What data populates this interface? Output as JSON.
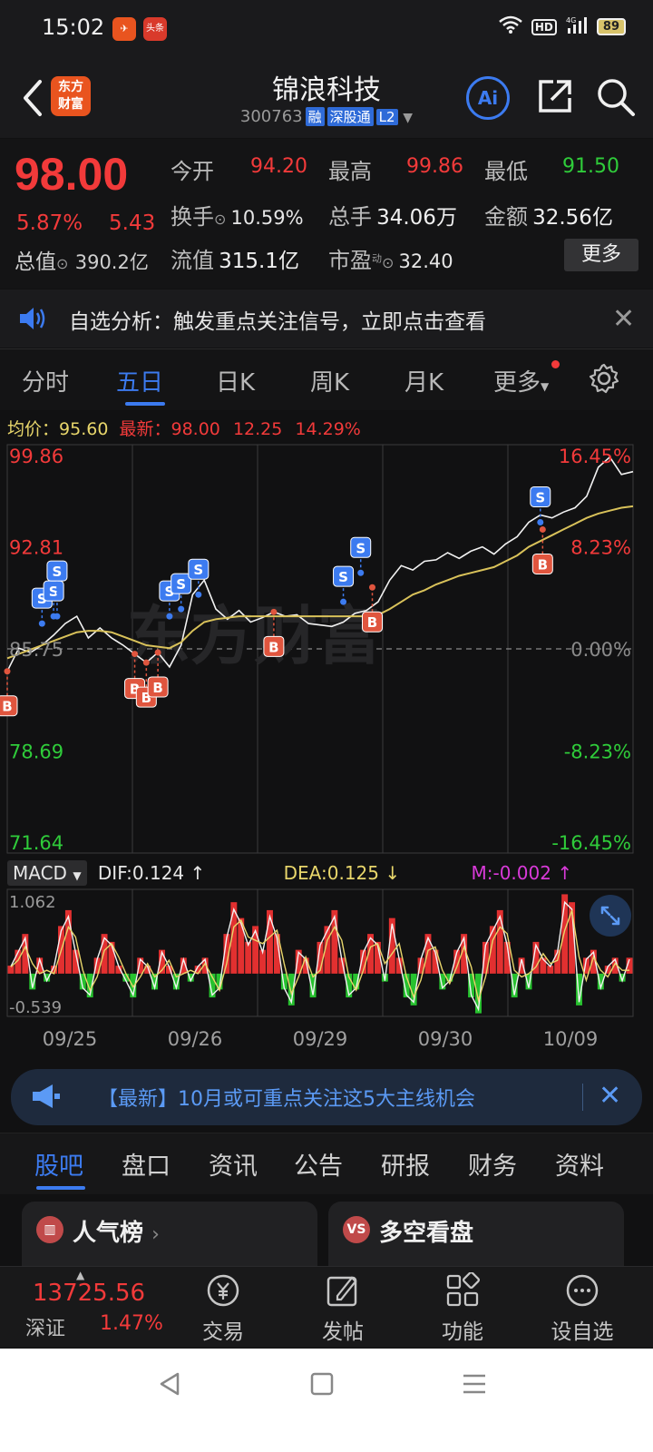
{
  "status": {
    "time": "15:02",
    "battery": "89",
    "badge2": "头条"
  },
  "header": {
    "logo_line1": "东方",
    "logo_line2": "财富",
    "stock_name": "锦浪科技",
    "stock_code": "300763",
    "tags": [
      "融",
      "深股通",
      "L2"
    ],
    "ai_label": "Ai"
  },
  "quote": {
    "price": "98.00",
    "change_pct": "5.87%",
    "change_abs": "5.43",
    "open_label": "今开",
    "open": "94.20",
    "high_label": "最高",
    "high": "99.86",
    "low_label": "最低",
    "low": "91.50",
    "turnover_label": "换手",
    "turnover": "10.59%",
    "volume_label": "总手",
    "volume": "34.06万",
    "amount_label": "金额",
    "amount": "32.56亿",
    "mcap_label": "总值",
    "mcap": "390.2亿",
    "float_label": "流值",
    "float": "315.1亿",
    "pe_label": "市盈",
    "pe_sup": "动",
    "pe": "32.40",
    "more": "更多"
  },
  "notice": {
    "text": "自选分析：触发重点关注信号，立即点击查看"
  },
  "chart_tabs": [
    "分时",
    "五日",
    "日K",
    "周K",
    "月K",
    "更多"
  ],
  "avg_row": {
    "avg_label": "均价：",
    "avg_value": "95.60",
    "latest_label": "最新：",
    "latest_value": "98.00",
    "latest_chg": "12.25",
    "latest_pct": "14.29%"
  },
  "chart_data": {
    "type": "line",
    "x_labels": [
      "09/25",
      "09/26",
      "09/29",
      "09/30",
      "10/09"
    ],
    "y_left_ticks": [
      "99.86",
      "92.81",
      "85.75",
      "78.69",
      "71.64"
    ],
    "y_right_ticks": [
      "16.45%",
      "8.23%",
      "0.00%",
      "-8.23%",
      "-16.45%"
    ],
    "ylim": [
      71.64,
      99.86
    ],
    "prev_close": 85.75,
    "series": [
      {
        "values": [
          84.2,
          85.8,
          85.5,
          86.0,
          86.7,
          87.5,
          88.0,
          86.5,
          87.2,
          86.5,
          86.0,
          85.4,
          84.8,
          85.5,
          84.5,
          86.0,
          89.5,
          90.5,
          88.5,
          87.8,
          88.4,
          87.6,
          87.9,
          88.3,
          88.0,
          88.1,
          87.5,
          87.4,
          87.3,
          87.6,
          88.2,
          88.4,
          89.0,
          90.5,
          91.5,
          91.2,
          91.8,
          91.9,
          92.4,
          92.0,
          92.5,
          92.8,
          92.3,
          93.0,
          93.5,
          94.5,
          95.0,
          94.8,
          95.2,
          95.5,
          96.3,
          98.3,
          99.0,
          97.8,
          98.0
        ]
      },
      {
        "values": [
          85.1,
          85.4,
          85.7,
          86.0,
          86.3,
          86.6,
          86.9,
          87.0,
          87.0,
          86.9,
          86.6,
          86.3,
          86.0,
          85.9,
          85.8,
          86.2,
          87.0,
          87.6,
          87.8,
          87.9,
          88.0,
          88.0,
          88.0,
          88.0,
          88.0,
          88.0,
          88.0,
          88.0,
          88.0,
          88.0,
          88.0,
          88.0,
          88.1,
          88.5,
          89.0,
          89.5,
          89.8,
          90.2,
          90.5,
          90.8,
          91.0,
          91.2,
          91.4,
          91.8,
          92.2,
          92.8,
          93.2,
          93.6,
          94.0,
          94.4,
          94.8,
          95.1,
          95.3,
          95.5,
          95.6
        ]
      }
    ],
    "markers": [
      {
        "type": "B",
        "x": 0,
        "price": 84.2
      },
      {
        "type": "S",
        "x": 3,
        "price": 87.5
      },
      {
        "type": "S",
        "x": 4,
        "price": 88.0
      },
      {
        "type": "S",
        "x": 4.3,
        "price": 88.0
      },
      {
        "type": "B",
        "x": 11,
        "price": 85.4
      },
      {
        "type": "B",
        "x": 12,
        "price": 84.8
      },
      {
        "type": "B",
        "x": 13,
        "price": 85.5
      },
      {
        "type": "S",
        "x": 14,
        "price": 88.0
      },
      {
        "type": "S",
        "x": 15,
        "price": 88.5
      },
      {
        "type": "S",
        "x": 16.5,
        "price": 89.5
      },
      {
        "type": "B",
        "x": 23,
        "price": 88.3
      },
      {
        "type": "S",
        "x": 29,
        "price": 89.0
      },
      {
        "type": "S",
        "x": 30.5,
        "price": 91.0
      },
      {
        "type": "B",
        "x": 31.5,
        "price": 90.0
      },
      {
        "type": "S",
        "x": 46,
        "price": 94.5
      },
      {
        "type": "B",
        "x": 46.2,
        "price": 94.0
      }
    ],
    "macd": {
      "dif": "DIF:0.124",
      "dea": "DEA:0.125",
      "m": "M:-0.002",
      "ylim_top": "1.062",
      "ylim_bottom": "-0.539",
      "selector": "MACD",
      "bars": [
        0.1,
        0.3,
        0.5,
        -0.2,
        0.2,
        -0.1,
        0.1,
        0.6,
        0.8,
        0.3,
        -0.2,
        -0.3,
        0.2,
        0.5,
        0.4,
        0.1,
        -0.1,
        -0.3,
        0.2,
        0.1,
        -0.2,
        0.3,
        0.1,
        -0.2,
        0.2,
        -0.1,
        0.1,
        0.2,
        -0.3,
        -0.2,
        0.5,
        0.9,
        0.7,
        0.4,
        0.6,
        0.3,
        0.8,
        0.5,
        -0.2,
        -0.4,
        0.3,
        0.2,
        -0.3,
        0.4,
        0.6,
        0.8,
        0.2,
        -0.3,
        -0.2,
        0.3,
        0.5,
        0.4,
        -0.1,
        0.7,
        0.2,
        -0.3,
        -0.4,
        0.2,
        0.5,
        0.3,
        -0.2,
        -0.1,
        0.3,
        0.5,
        -0.3,
        -0.5,
        0.4,
        0.6,
        0.8,
        0.4,
        -0.3,
        0.2,
        -0.2,
        0.4,
        0.2,
        0.1,
        0.3,
        1.0,
        0.9,
        -0.4,
        0.2,
        0.3,
        -0.2,
        0.1,
        0.2,
        -0.1,
        0.2
      ]
    }
  },
  "news": {
    "text": "【最新】10月或可重点关注这5大主线机会"
  },
  "info_tabs": [
    "股吧",
    "盘口",
    "资讯",
    "公告",
    "研报",
    "财务",
    "资料"
  ],
  "cards": {
    "left_title": "人气榜",
    "right_title": "多空看盘",
    "right_icon": "VS"
  },
  "bottom_nav": {
    "index_value": "13725.56",
    "index_name": "深证",
    "index_pct": "1.47%",
    "items": [
      "交易",
      "发帖",
      "功能",
      "设自选"
    ]
  }
}
